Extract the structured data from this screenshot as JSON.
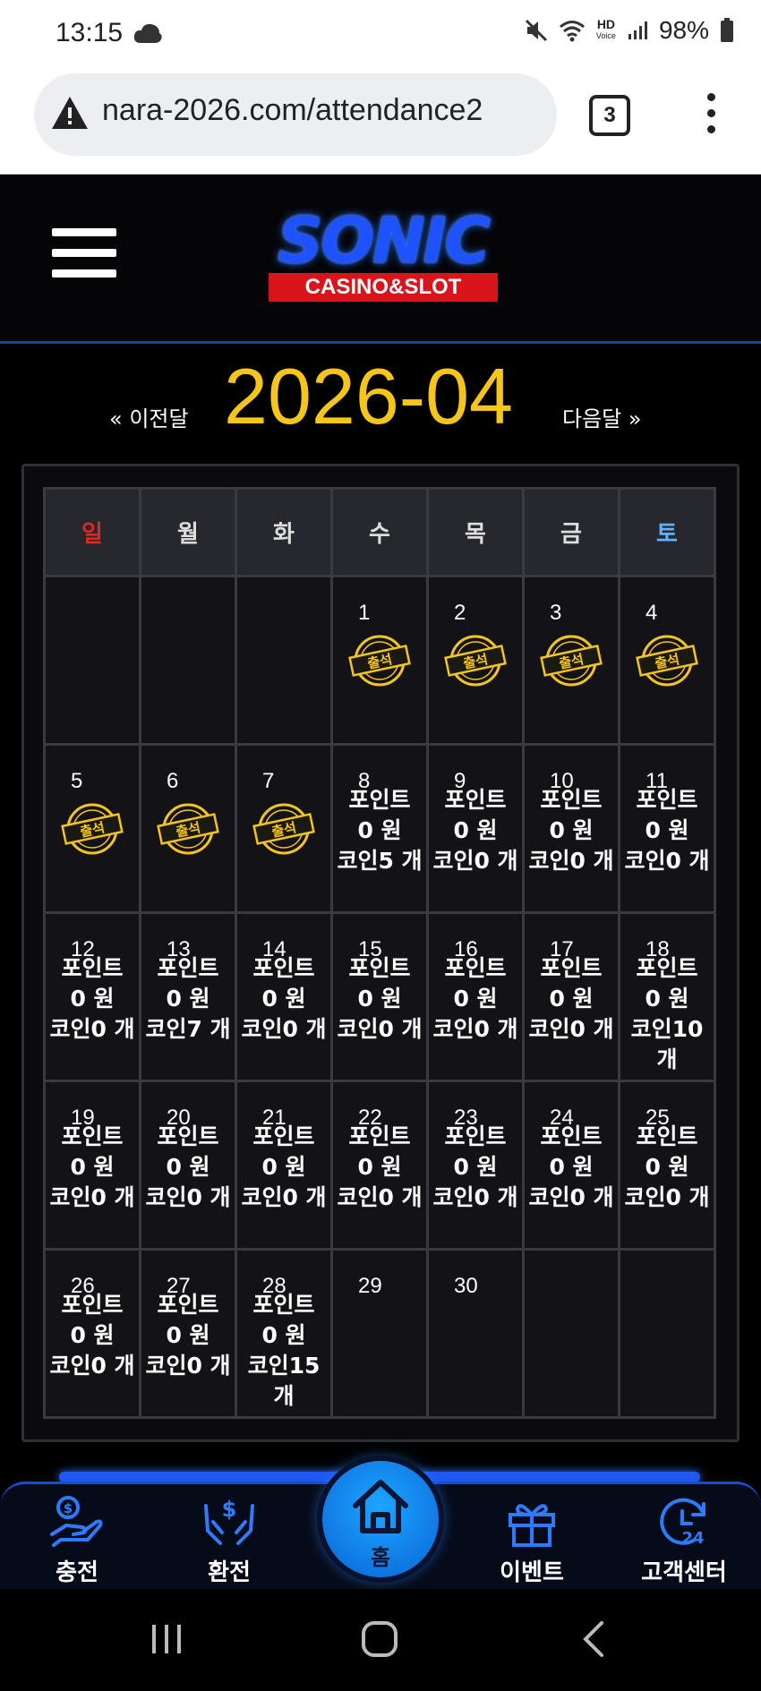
{
  "status_bar": {
    "time": "13:15",
    "battery": "98%",
    "network_label": "HD",
    "network_sub": "Voice"
  },
  "browser": {
    "url": "nara-2026.com/attendance2",
    "tab_count": "3"
  },
  "header": {
    "logo_main": "SONIC",
    "logo_sub": "CASINO&SLOT"
  },
  "month_nav": {
    "prev": "« 이전달",
    "month": "2026-04",
    "next": "다음달 »"
  },
  "calendar": {
    "weekdays": [
      "일",
      "월",
      "화",
      "수",
      "목",
      "금",
      "토"
    ],
    "weekday_colors": {
      "sunday": "#e3261f",
      "saturday": "#5fb2ff",
      "weekday": "#dddddd"
    },
    "stamp_label": "출석",
    "weeks": [
      [
        {
          "day": "",
          "type": "empty"
        },
        {
          "day": "",
          "type": "empty"
        },
        {
          "day": "",
          "type": "empty"
        },
        {
          "day": "1",
          "type": "stamp"
        },
        {
          "day": "2",
          "type": "stamp"
        },
        {
          "day": "3",
          "type": "stamp"
        },
        {
          "day": "4",
          "type": "stamp"
        }
      ],
      [
        {
          "day": "5",
          "type": "stamp"
        },
        {
          "day": "6",
          "type": "stamp"
        },
        {
          "day": "7",
          "type": "stamp"
        },
        {
          "day": "8",
          "type": "reward",
          "point_label": "포인트",
          "point": "0 원",
          "coin": "코인5 개"
        },
        {
          "day": "9",
          "type": "reward",
          "point_label": "포인트",
          "point": "0 원",
          "coin": "코인0 개"
        },
        {
          "day": "10",
          "type": "reward",
          "point_label": "포인트",
          "point": "0 원",
          "coin": "코인0 개"
        },
        {
          "day": "11",
          "type": "reward",
          "point_label": "포인트",
          "point": "0 원",
          "coin": "코인0 개"
        }
      ],
      [
        {
          "day": "12",
          "type": "reward",
          "point_label": "포인트",
          "point": "0 원",
          "coin": "코인0 개"
        },
        {
          "day": "13",
          "type": "reward",
          "point_label": "포인트",
          "point": "0 원",
          "coin": "코인7 개"
        },
        {
          "day": "14",
          "type": "reward",
          "point_label": "포인트",
          "point": "0 원",
          "coin": "코인0 개"
        },
        {
          "day": "15",
          "type": "reward",
          "point_label": "포인트",
          "point": "0 원",
          "coin": "코인0 개"
        },
        {
          "day": "16",
          "type": "reward",
          "point_label": "포인트",
          "point": "0 원",
          "coin": "코인0 개"
        },
        {
          "day": "17",
          "type": "reward",
          "point_label": "포인트",
          "point": "0 원",
          "coin": "코인0 개"
        },
        {
          "day": "18",
          "type": "reward",
          "point_label": "포인트",
          "point": "0 원",
          "coin": "코인10 개"
        }
      ],
      [
        {
          "day": "19",
          "type": "reward",
          "point_label": "포인트",
          "point": "0 원",
          "coin": "코인0 개"
        },
        {
          "day": "20",
          "type": "reward",
          "point_label": "포인트",
          "point": "0 원",
          "coin": "코인0 개"
        },
        {
          "day": "21",
          "type": "reward",
          "point_label": "포인트",
          "point": "0 원",
          "coin": "코인0 개"
        },
        {
          "day": "22",
          "type": "reward",
          "point_label": "포인트",
          "point": "0 원",
          "coin": "코인0 개"
        },
        {
          "day": "23",
          "type": "reward",
          "point_label": "포인트",
          "point": "0 원",
          "coin": "코인0 개"
        },
        {
          "day": "24",
          "type": "reward",
          "point_label": "포인트",
          "point": "0 원",
          "coin": "코인0 개"
        },
        {
          "day": "25",
          "type": "reward",
          "point_label": "포인트",
          "point": "0 원",
          "coin": "코인0 개"
        }
      ],
      [
        {
          "day": "26",
          "type": "reward",
          "point_label": "포인트",
          "point": "0 원",
          "coin": "코인0 개"
        },
        {
          "day": "27",
          "type": "reward",
          "point_label": "포인트",
          "point": "0 원",
          "coin": "코인0 개"
        },
        {
          "day": "28",
          "type": "reward",
          "point_label": "포인트",
          "point": "0 원",
          "coin": "코인15 개"
        },
        {
          "day": "29",
          "type": "plain"
        },
        {
          "day": "30",
          "type": "plain"
        },
        {
          "day": "",
          "type": "empty"
        },
        {
          "day": "",
          "type": "empty"
        }
      ]
    ]
  },
  "bottom_nav": {
    "items": [
      {
        "label": "충전",
        "icon": "deposit-hand-coin-icon"
      },
      {
        "label": "환전",
        "icon": "exchange-dollar-hands-icon"
      },
      {
        "label": "홈",
        "icon": "home-icon"
      },
      {
        "label": "이벤트",
        "icon": "gift-icon"
      },
      {
        "label": "고객센터",
        "icon": "support-24-icon"
      }
    ]
  },
  "colors": {
    "accent_yellow": "#f5c518",
    "nav_blue": "#1d4ad3",
    "logo_red": "#d9141b"
  }
}
